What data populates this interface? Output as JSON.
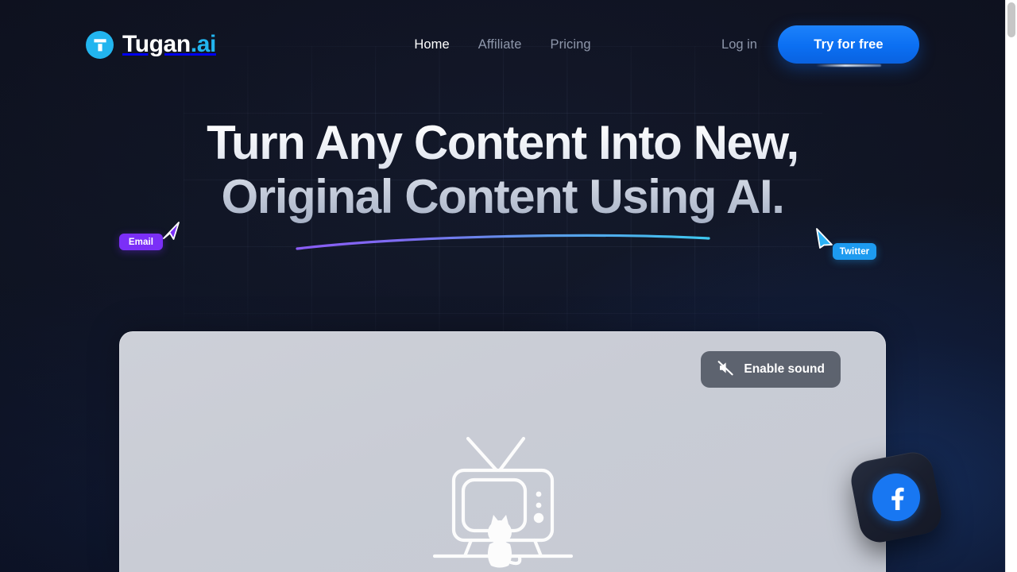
{
  "brand": {
    "name": "Tugan",
    "suffix": ".ai",
    "logo_icon": "tugan-t-logo-icon",
    "logo_color": "#22b5ef"
  },
  "nav": {
    "items": [
      {
        "label": "Home",
        "active": true
      },
      {
        "label": "Affiliate",
        "active": false
      },
      {
        "label": "Pricing",
        "active": false
      }
    ]
  },
  "header_actions": {
    "login_label": "Log in",
    "cta_label": "Try for free",
    "cta_color": "#0b6ff2"
  },
  "hero": {
    "headline_line1": "Turn Any Content Into New,",
    "headline_line2": "Original Content Using AI.",
    "headline": "Turn Any Content Into New,\nOriginal Content Using AI."
  },
  "badges": [
    {
      "label": "Email",
      "color": "#7b2ff7",
      "cursor_icon": "cursor-arrow-icon"
    },
    {
      "label": "Twitter",
      "color": "#1d9bf0",
      "cursor_icon": "cursor-arrow-icon"
    }
  ],
  "connector": {
    "gradient_start": "#8b5cf6",
    "gradient_end": "#38bdf8"
  },
  "video": {
    "sound_button_label": "Enable sound",
    "sound_icon": "speaker-muted-icon",
    "placeholder_icon": "retro-tv-with-cat-icon",
    "placeholder_bg": "#c9ccd5"
  },
  "floating_card": {
    "icon": "facebook-icon",
    "icon_color": "#1877f2"
  },
  "theme": {
    "background": "#11162a",
    "accent": "#22b5ef",
    "text_muted": "#8e97ab"
  }
}
